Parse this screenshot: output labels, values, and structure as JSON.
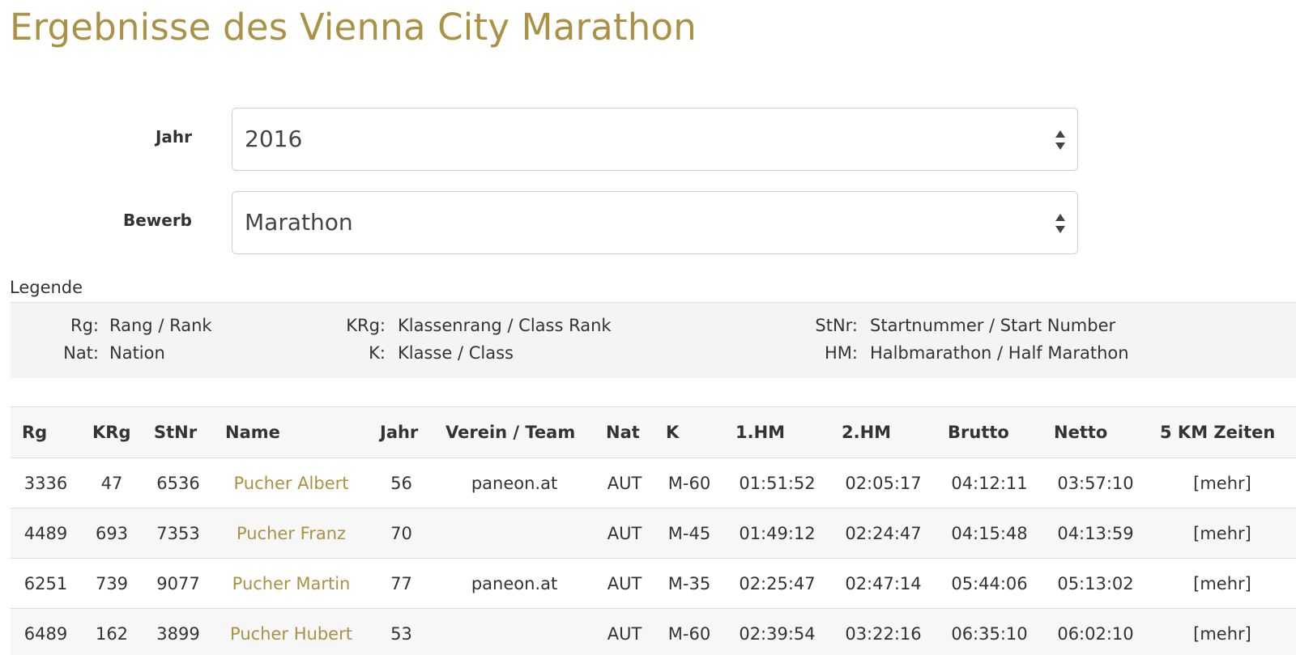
{
  "title": "Ergebnisse des Vienna City Marathon",
  "form": {
    "year_label": "Jahr",
    "year_value": "2016",
    "event_label": "Bewerb",
    "event_value": "Marathon"
  },
  "legend": {
    "heading": "Legende",
    "items": [
      {
        "key": "Rg:",
        "value": "Rang / Rank"
      },
      {
        "key": "Nat:",
        "value": "Nation"
      },
      {
        "key": "KRg:",
        "value": "Klassenrang / Class Rank"
      },
      {
        "key": "K:",
        "value": "Klasse / Class"
      },
      {
        "key": "StNr:",
        "value": "Startnummer / Start Number"
      },
      {
        "key": "HM:",
        "value": "Halbmarathon / Half Marathon"
      }
    ]
  },
  "table": {
    "columns": [
      "Rg",
      "KRg",
      "StNr",
      "Name",
      "Jahr",
      "Verein / Team",
      "Nat",
      "K",
      "1.HM",
      "2.HM",
      "Brutto",
      "Netto",
      "5 KM Zeiten"
    ],
    "rows": [
      {
        "rg": "3336",
        "krg": "47",
        "stnr": "6536",
        "name": "Pucher Albert",
        "jahr": "56",
        "team": "paneon.at",
        "nat": "AUT",
        "k": "M-60",
        "hm1": "01:51:52",
        "hm2": "02:05:17",
        "brutto": "04:12:11",
        "netto": "03:57:10",
        "more": "[mehr]"
      },
      {
        "rg": "4489",
        "krg": "693",
        "stnr": "7353",
        "name": "Pucher Franz",
        "jahr": "70",
        "team": "",
        "nat": "AUT",
        "k": "M-45",
        "hm1": "01:49:12",
        "hm2": "02:24:47",
        "brutto": "04:15:48",
        "netto": "04:13:59",
        "more": "[mehr]"
      },
      {
        "rg": "6251",
        "krg": "739",
        "stnr": "9077",
        "name": "Pucher Martin",
        "jahr": "77",
        "team": "paneon.at",
        "nat": "AUT",
        "k": "M-35",
        "hm1": "02:25:47",
        "hm2": "02:47:14",
        "brutto": "05:44:06",
        "netto": "05:13:02",
        "more": "[mehr]"
      },
      {
        "rg": "6489",
        "krg": "162",
        "stnr": "3899",
        "name": "Pucher Hubert",
        "jahr": "53",
        "team": "",
        "nat": "AUT",
        "k": "M-60",
        "hm1": "02:39:54",
        "hm2": "03:22:16",
        "brutto": "06:35:10",
        "netto": "06:02:10",
        "more": "[mehr]"
      }
    ]
  },
  "colors": {
    "accent": "#ab9144",
    "text": "#333333",
    "row_alt": "#f7f7f7",
    "legend_bg": "#f4f4f4"
  }
}
